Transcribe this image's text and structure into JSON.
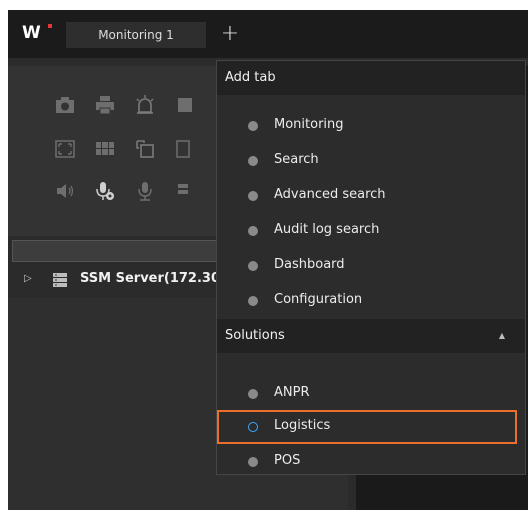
{
  "app": {
    "logo_text": "W",
    "tab_label": "Monitoring 1",
    "add_tab_symbol": "+"
  },
  "tree": {
    "server_label": "SSM Server(172.30"
  },
  "dropdown": {
    "header": "Add tab",
    "items": [
      "Monitoring",
      "Search",
      "Advanced search",
      "Audit log search",
      "Dashboard",
      "Configuration"
    ],
    "section_label": "Solutions",
    "solutions": [
      "ANPR",
      "Logistics",
      "POS"
    ],
    "selected": "Logistics"
  },
  "colors": {
    "highlight_border": "#e8702a",
    "selected_ring": "#3ba7ff",
    "logo_dot": "#e53935"
  }
}
